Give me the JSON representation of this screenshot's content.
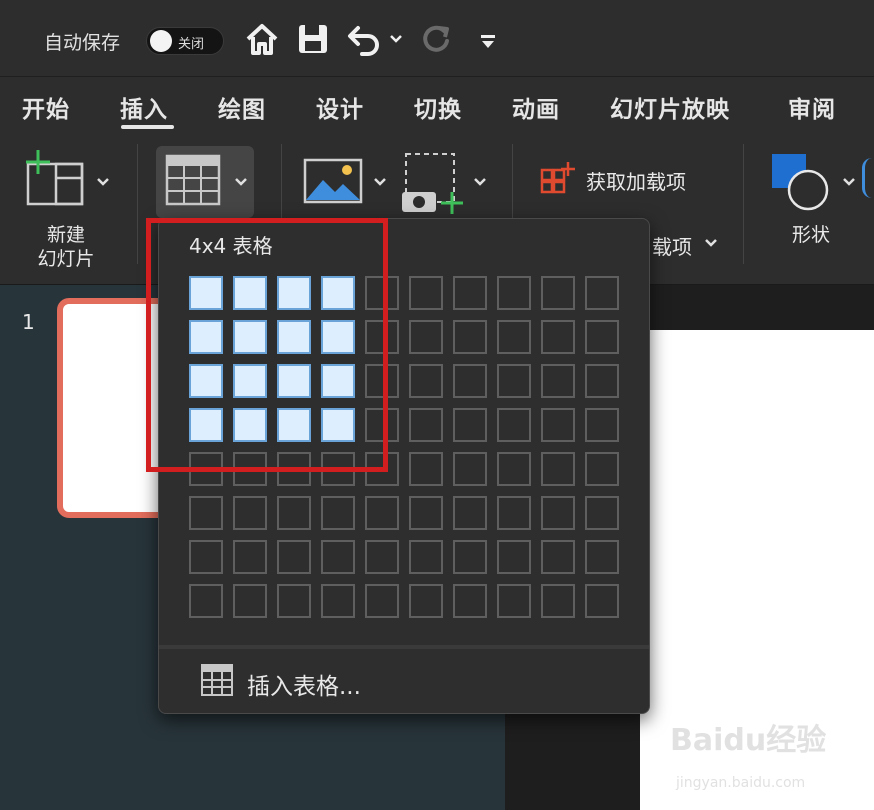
{
  "titlebar": {
    "autosave_label": "自动保存",
    "autosave_state": "关闭"
  },
  "tabs": [
    "开始",
    "插入",
    "绘图",
    "设计",
    "切换",
    "动画",
    "幻灯片放映",
    "审阅"
  ],
  "active_tab": "插入",
  "toolbar": {
    "new_slide_line1": "新建",
    "new_slide_line2": "幻灯片",
    "addins_get": "获取加载项",
    "addins_partial": "载项",
    "shapes": "形状"
  },
  "slide_panel": {
    "slide_number": "1"
  },
  "table_picker": {
    "label": "4x4 表格",
    "rows": 8,
    "cols": 10,
    "selected_rows": 4,
    "selected_cols": 4,
    "insert_table": "插入表格..."
  },
  "watermark": {
    "brand": "Baidu经验",
    "url": "jingyan.baidu.com"
  }
}
